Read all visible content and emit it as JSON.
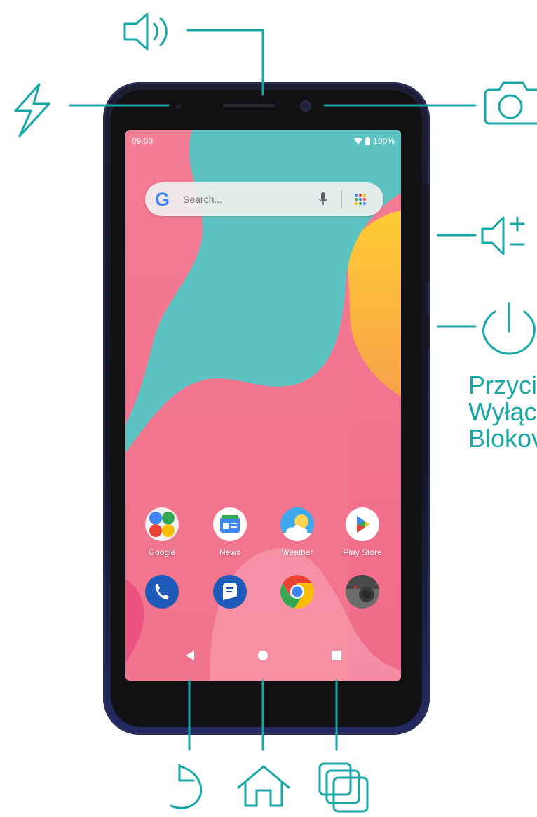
{
  "status_bar": {
    "time": "09:00",
    "battery": "100%"
  },
  "search": {
    "placeholder": "Search..."
  },
  "apps": [
    {
      "label": "Google"
    },
    {
      "label": "News"
    },
    {
      "label": "Weather"
    },
    {
      "label": "Play Store"
    }
  ],
  "dock": [
    "phone-icon",
    "messages-icon",
    "chrome-icon",
    "camera-icon"
  ],
  "callouts": {
    "power_text": [
      "Przyci",
      "Wyłąc",
      "Blokov"
    ]
  },
  "colors": {
    "accent": "#17a7a5"
  }
}
